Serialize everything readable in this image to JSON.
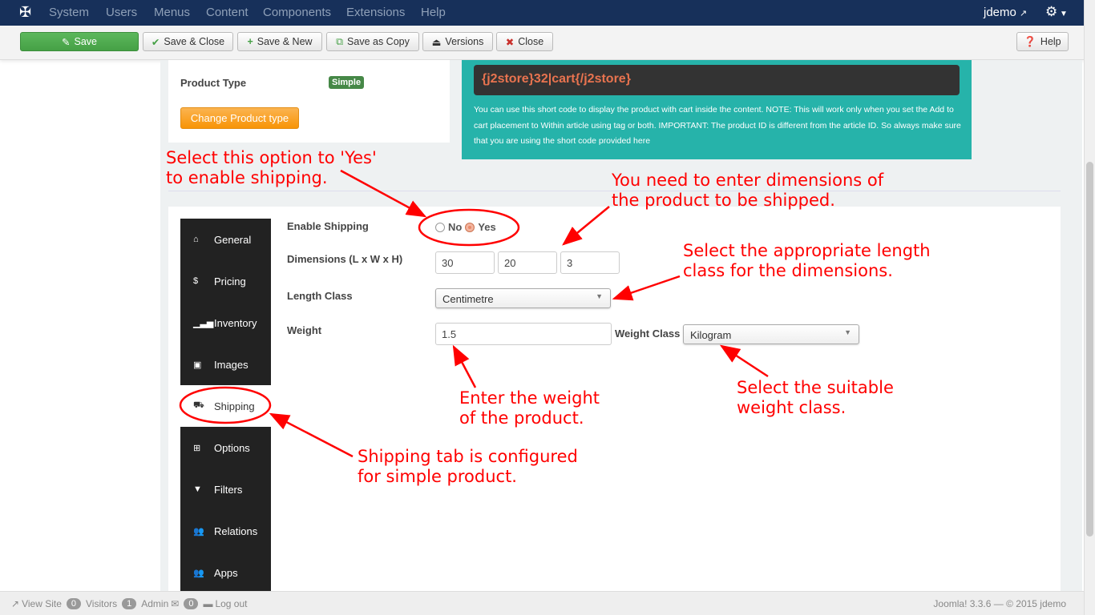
{
  "topbar": {
    "menu": [
      "System",
      "Users",
      "Menus",
      "Content",
      "Components",
      "Extensions",
      "Help"
    ],
    "user": "jdemo"
  },
  "toolbar": {
    "save": "Save",
    "save_close": "Save & Close",
    "save_new": "Save & New",
    "save_copy": "Save as Copy",
    "versions": "Versions",
    "close": "Close",
    "help": "Help"
  },
  "product": {
    "type_label": "Product Type",
    "type_badge": "Simple",
    "change_button": "Change Product type"
  },
  "shortcode": {
    "code": "{j2store}32|cart{/j2store}",
    "note": "You can use this short code to display the product with cart inside the content. NOTE: This will work only when you set the Add to cart placement to Within article using tag or both. IMPORTANT: The product ID is different from the article ID. So always make sure that you are using the short code provided here"
  },
  "tabs": [
    {
      "label": "General",
      "icon": "home-icon"
    },
    {
      "label": "Pricing",
      "icon": "dollar-icon"
    },
    {
      "label": "Inventory",
      "icon": "signal-icon"
    },
    {
      "label": "Images",
      "icon": "image-icon"
    },
    {
      "label": "Shipping",
      "icon": "truck-icon"
    },
    {
      "label": "Options",
      "icon": "sitemap-icon"
    },
    {
      "label": "Filters",
      "icon": "filter-icon"
    },
    {
      "label": "Relations",
      "icon": "users-icon"
    },
    {
      "label": "Apps",
      "icon": "users-icon"
    }
  ],
  "shipping": {
    "enable_label": "Enable Shipping",
    "no": "No",
    "yes": "Yes",
    "selected": "Yes",
    "dims_label": "Dimensions (L x W x H)",
    "length": "30",
    "width": "20",
    "height": "3",
    "length_class_label": "Length Class",
    "length_class": "Centimetre",
    "weight_label": "Weight",
    "weight": "1.5",
    "weight_class_label": "Weight Class",
    "weight_class": "Kilogram"
  },
  "annotations": {
    "a1": "Select this option to 'Yes'\nto enable shipping.",
    "a2": "You need to enter dimensions of\nthe product to be shipped.",
    "a3": "Select the appropriate length\nclass for the dimensions.",
    "a4": "Enter the weight\nof the product.",
    "a5": "Select the suitable\nweight class.",
    "a6": "Shipping tab is configured\nfor simple product."
  },
  "annotation_color": "#ff0000",
  "footer": {
    "view_site": "View Site",
    "visitors_count": "0",
    "visitors": "Visitors",
    "admin_count": "1",
    "admin": "Admin",
    "messages_count": "0",
    "logout": "Log out",
    "version": "Joomla! 3.3.6 — © 2015 jdemo"
  }
}
